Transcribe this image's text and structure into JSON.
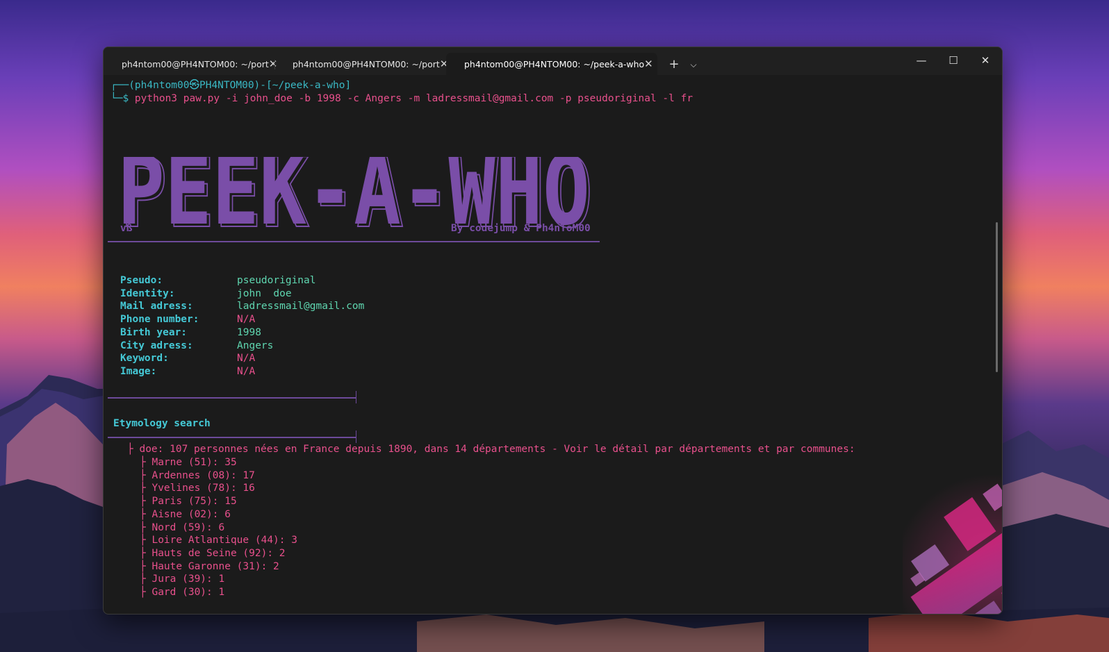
{
  "tabs": [
    {
      "label": "ph4ntom00@PH4NTOM00: ~/port"
    },
    {
      "label": "ph4ntom00@PH4NTOM00: ~/port"
    },
    {
      "label": "ph4ntom00@PH4NTOM00: ~/peek-a-who"
    }
  ],
  "tab_close_glyph": "✕",
  "new_tab_glyph": "+",
  "tab_dropdown_glyph": "⌵",
  "window_controls": {
    "minimize": "—",
    "maximize": "☐",
    "close": "✕"
  },
  "prompt": {
    "line1": "┌──(ph4ntom00㉿PH4NTOM00)-[~/peek-a-who]",
    "line2_prefix": "└─$ ",
    "command": "python3 paw.py -i john_doe -b 1998 -c Angers -m ladressmail@gmail.com -p pseudoriginal -l fr"
  },
  "banner": {
    "title": "PEEK-A-WHO",
    "version": "vß",
    "credits": "By codejump & Ph4nToM00"
  },
  "info": [
    {
      "label": "Pseudo:",
      "value": "pseudoriginal",
      "na": false
    },
    {
      "label": "Identity:",
      "value": "john  doe",
      "na": false
    },
    {
      "label": "Mail adress:",
      "value": "ladressmail@gmail.com",
      "na": false
    },
    {
      "label": "Phone number:",
      "value": "N/A",
      "na": true
    },
    {
      "label": "Birth year:",
      "value": "1998",
      "na": false
    },
    {
      "label": "City adress:",
      "value": "Angers",
      "na": false
    },
    {
      "label": "Keyword:",
      "value": "N/A",
      "na": true
    },
    {
      "label": "Image:",
      "value": "N/A",
      "na": true
    }
  ],
  "etymology": {
    "heading": "Etymology search",
    "root": "├ doe: 107 personnes nées en France depuis 1890, dans 14 départements - Voir le détail par départements et par communes:",
    "items": [
      "├ Marne (51): 35",
      "├ Ardennes (08): 17",
      "├ Yvelines (78): 16",
      "├ Paris (75): 15",
      "├ Aisne (02): 6",
      "├ Nord (59): 6",
      "├ Loire Atlantique (44): 3",
      "├ Hauts de Seine (92): 2",
      "├ Haute Garonne (31): 2",
      "├ Jura (39): 1",
      "├ Gard (30): 1"
    ]
  },
  "colors": {
    "prompt": "#3ab8c4",
    "command": "#e8508c",
    "label": "#45c9d6",
    "value": "#5fd6b0",
    "na": "#e8508c",
    "banner": "#7a4ea8"
  }
}
